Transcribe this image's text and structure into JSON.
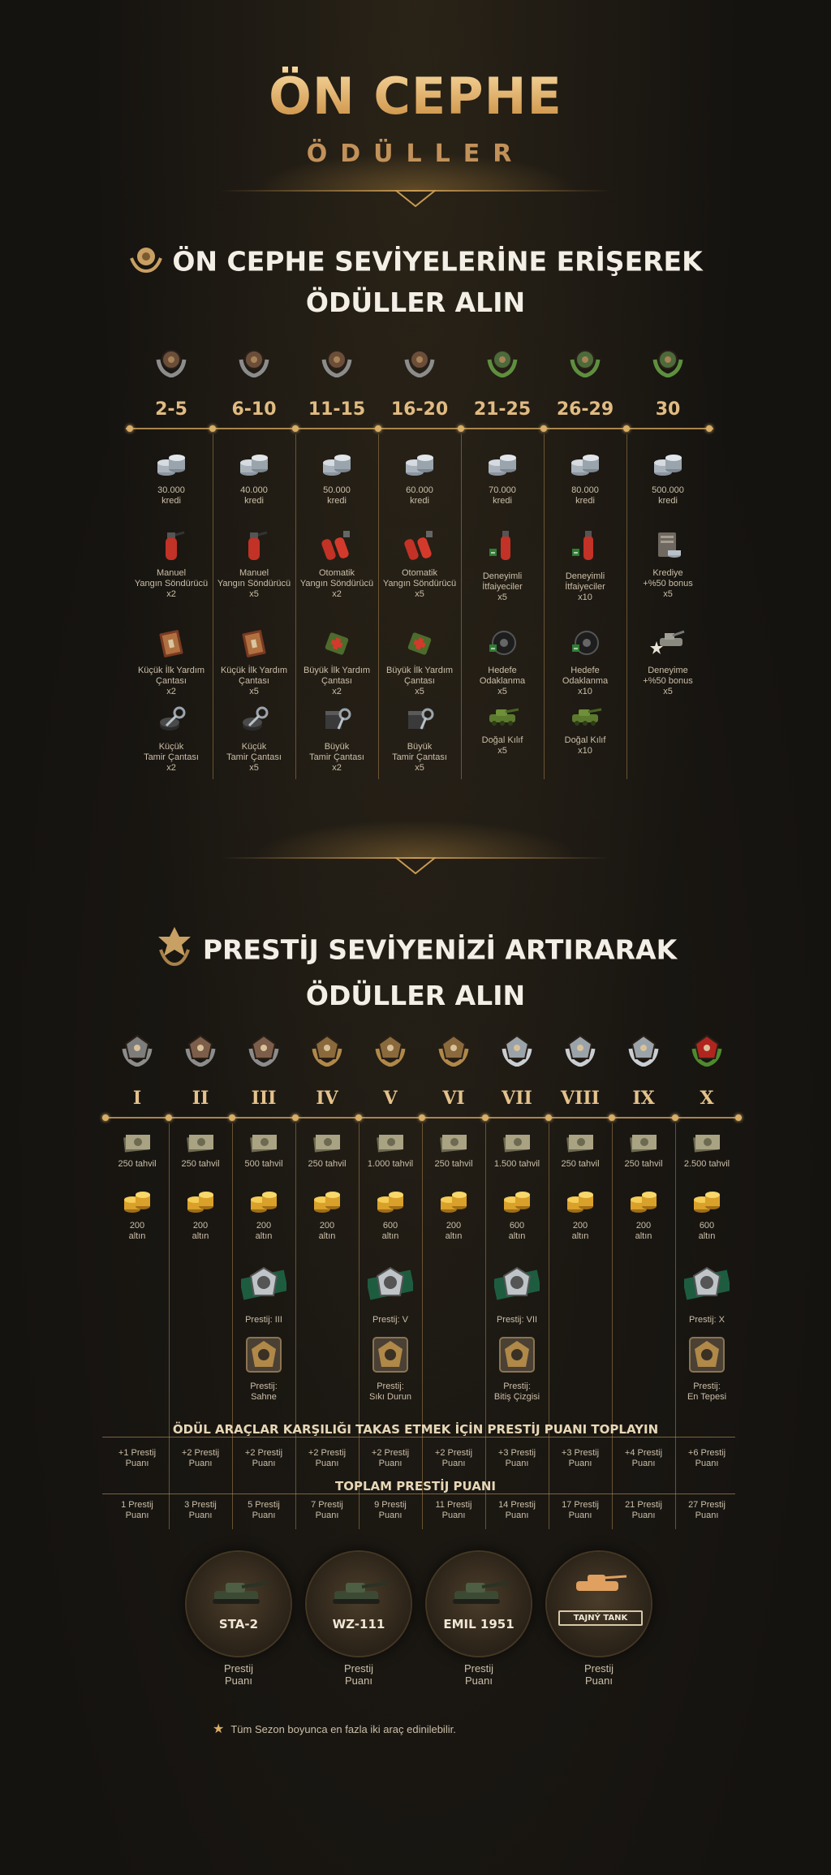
{
  "header": {
    "title": "ÖN CEPHE",
    "subtitle": "ÖDÜLLER"
  },
  "section1": {
    "title_line1": "ÖN CEPHE SEVİYELERİNE ERİŞEREK",
    "title_line2": "ÖDÜLLER ALIN",
    "levels": [
      "2-5",
      "6-10",
      "11-15",
      "16-20",
      "21-25",
      "26-29",
      "30"
    ],
    "rewards": [
      [
        {
          "icon": "credits-icon",
          "lines": [
            "30.000",
            "kredi"
          ]
        },
        {
          "icon": "fire-extinguisher-icon",
          "lines": [
            "Manuel",
            "Yangın Söndürücü",
            "x2"
          ]
        },
        {
          "icon": "first-aid-kit-icon",
          "lines": [
            "Küçük İlk Yardım",
            "Çantası",
            "x2"
          ]
        },
        {
          "icon": "repair-kit-icon",
          "lines": [
            "Küçük",
            "Tamir Çantası",
            "x2"
          ]
        }
      ],
      [
        {
          "icon": "credits-icon",
          "lines": [
            "40.000",
            "kredi"
          ]
        },
        {
          "icon": "fire-extinguisher-icon",
          "lines": [
            "Manuel",
            "Yangın Söndürücü",
            "x5"
          ]
        },
        {
          "icon": "first-aid-kit-icon",
          "lines": [
            "Küçük İlk Yardım",
            "Çantası",
            "x5"
          ]
        },
        {
          "icon": "repair-kit-icon",
          "lines": [
            "Küçük",
            "Tamir Çantası",
            "x5"
          ]
        }
      ],
      [
        {
          "icon": "credits-icon",
          "lines": [
            "50.000",
            "kredi"
          ]
        },
        {
          "icon": "auto-extinguisher-icon",
          "lines": [
            "Otomatik",
            "Yangın Söndürücü",
            "x2"
          ]
        },
        {
          "icon": "large-first-aid-kit-icon",
          "lines": [
            "Büyük İlk Yardım",
            "Çantası",
            "x2"
          ]
        },
        {
          "icon": "large-repair-kit-icon",
          "lines": [
            "Büyük",
            "Tamir Çantası",
            "x2"
          ]
        }
      ],
      [
        {
          "icon": "credits-icon",
          "lines": [
            "60.000",
            "kredi"
          ]
        },
        {
          "icon": "auto-extinguisher-icon",
          "lines": [
            "Otomatik",
            "Yangın Söndürücü",
            "x5"
          ]
        },
        {
          "icon": "large-first-aid-kit-icon",
          "lines": [
            "Büyük İlk Yardım",
            "Çantası",
            "x5"
          ]
        },
        {
          "icon": "large-repair-kit-icon",
          "lines": [
            "Büyük",
            "Tamir Çantası",
            "x5"
          ]
        }
      ],
      [
        {
          "icon": "credits-icon",
          "lines": [
            "70.000",
            "kredi"
          ]
        },
        {
          "icon": "firefighters-icon",
          "lines": [
            "Deneyimli",
            "İtfaiyeciler",
            "x5"
          ]
        },
        {
          "icon": "target-icon",
          "lines": [
            "Hedefe",
            "Odaklanma",
            "x5"
          ]
        },
        {
          "icon": "camouflage-icon",
          "lines": [
            "Doğal Kılıf",
            "x5"
          ]
        }
      ],
      [
        {
          "icon": "credits-icon",
          "lines": [
            "80.000",
            "kredi"
          ]
        },
        {
          "icon": "firefighters-icon",
          "lines": [
            "Deneyimli",
            "İtfaiyeciler",
            "x10"
          ]
        },
        {
          "icon": "target-icon",
          "lines": [
            "Hedefe",
            "Odaklanma",
            "x10"
          ]
        },
        {
          "icon": "camouflage-icon",
          "lines": [
            "Doğal Kılıf",
            "x10"
          ]
        }
      ],
      [
        {
          "icon": "credits-icon",
          "lines": [
            "500.000",
            "kredi"
          ]
        },
        {
          "icon": "credit-bonus-icon",
          "lines": [
            "Krediye",
            "+%50 bonus",
            "x5"
          ]
        },
        {
          "icon": "xp-bonus-icon",
          "lines": [
            "Deneyime",
            "+%50 bonus",
            "x5"
          ]
        }
      ]
    ]
  },
  "section2": {
    "title_line1": "PRESTİJ SEVİYENİZİ ARTIRARAK",
    "title_line2": "ÖDÜLLER ALIN",
    "levels": [
      "I",
      "II",
      "III",
      "IV",
      "V",
      "VI",
      "VII",
      "VIII",
      "IX",
      "X"
    ],
    "bonds": [
      "250 tahvil",
      "250 tahvil",
      "500 tahvil",
      "250 tahvil",
      "1.000 tahvil",
      "250 tahvil",
      "1.500 tahvil",
      "250 tahvil",
      "250 tahvil",
      "2.500 tahvil"
    ],
    "gold": [
      [
        "200",
        "altın"
      ],
      [
        "200",
        "altın"
      ],
      [
        "200",
        "altın"
      ],
      [
        "200",
        "altın"
      ],
      [
        "600",
        "altın"
      ],
      [
        "200",
        "altın"
      ],
      [
        "600",
        "altın"
      ],
      [
        "200",
        "altın"
      ],
      [
        "200",
        "altın"
      ],
      [
        "600",
        "altın"
      ]
    ],
    "emblems": [
      {
        "col": 2,
        "emblem": "Prestij: III",
        "badge": [
          "Prestij:",
          "Sahne"
        ]
      },
      {
        "col": 4,
        "emblem": "Prestij: V",
        "badge": [
          "Prestij:",
          "Sıkı Durun"
        ]
      },
      {
        "col": 6,
        "emblem": "Prestij: VII",
        "badge": [
          "Prestij:",
          "Bitiş Çizgisi"
        ]
      },
      {
        "col": 9,
        "emblem": "Prestij: X",
        "badge": [
          "Prestij:",
          "En Tepesi"
        ]
      }
    ],
    "band1_title": "ÖDÜL ARAÇLAR KARŞILIĞI TAKAS ETMEK İÇİN PRESTİJ PUANI TOPLAYIN",
    "points_per_level": [
      [
        "+1 Prestij",
        "Puanı"
      ],
      [
        "+2 Prestij",
        "Puanı"
      ],
      [
        "+2 Prestij",
        "Puanı"
      ],
      [
        "+2 Prestij",
        "Puanı"
      ],
      [
        "+2 Prestij",
        "Puanı"
      ],
      [
        "+2 Prestij",
        "Puanı"
      ],
      [
        "+3 Prestij",
        "Puanı"
      ],
      [
        "+3 Prestij",
        "Puanı"
      ],
      [
        "+4 Prestij",
        "Puanı"
      ],
      [
        "+6 Prestij",
        "Puanı"
      ]
    ],
    "band2_title": "TOPLAM PRESTİJ PUANI",
    "total_points": [
      [
        "1 Prestij",
        "Puanı"
      ],
      [
        "3 Prestij",
        "Puanı"
      ],
      [
        "5 Prestij",
        "Puanı"
      ],
      [
        "7 Prestij",
        "Puanı"
      ],
      [
        "9 Prestij",
        "Puanı"
      ],
      [
        "11 Prestij",
        "Puanı"
      ],
      [
        "14 Prestij",
        "Puanı"
      ],
      [
        "17 Prestij",
        "Puanı"
      ],
      [
        "21 Prestij",
        "Puanı"
      ],
      [
        "27 Prestij",
        "Puanı"
      ]
    ],
    "tanks": [
      {
        "name": "STA-2",
        "points": [
          "Prestij",
          "Puanı"
        ]
      },
      {
        "name": "WZ-111",
        "points": [
          "Prestij",
          "Puanı"
        ]
      },
      {
        "name": "EMIL 1951",
        "points": [
          "Prestij",
          "Puanı"
        ]
      },
      {
        "name": "TAJNÝ TANK",
        "points": [
          "Prestij",
          "Puanı"
        ]
      }
    ],
    "footnote": "Tüm Sezon boyunca en fazla iki araç edinilebilir."
  },
  "colors": {
    "accent": "#d9ae66",
    "background": "#151310",
    "text": "#cbbfa8"
  }
}
